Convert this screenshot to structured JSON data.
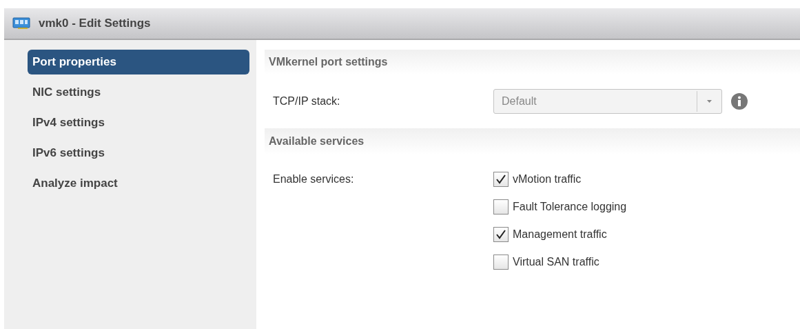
{
  "window": {
    "title": "vmk0 - Edit Settings"
  },
  "sidebar": {
    "items": [
      {
        "label": "Port properties",
        "selected": true
      },
      {
        "label": "NIC settings",
        "selected": false
      },
      {
        "label": "IPv4 settings",
        "selected": false
      },
      {
        "label": "IPv6 settings",
        "selected": false
      },
      {
        "label": "Analyze impact",
        "selected": false
      }
    ]
  },
  "sections": [
    {
      "title": "VMkernel port settings",
      "field": {
        "label": "TCP/IP stack:",
        "value": "Default",
        "disabled": true
      }
    },
    {
      "title": "Available services",
      "services_label": "Enable services:",
      "services": [
        {
          "label": "vMotion traffic",
          "checked": true
        },
        {
          "label": "Fault Tolerance logging",
          "checked": false
        },
        {
          "label": "Management traffic",
          "checked": true
        },
        {
          "label": "Virtual SAN traffic",
          "checked": false
        }
      ]
    }
  ]
}
